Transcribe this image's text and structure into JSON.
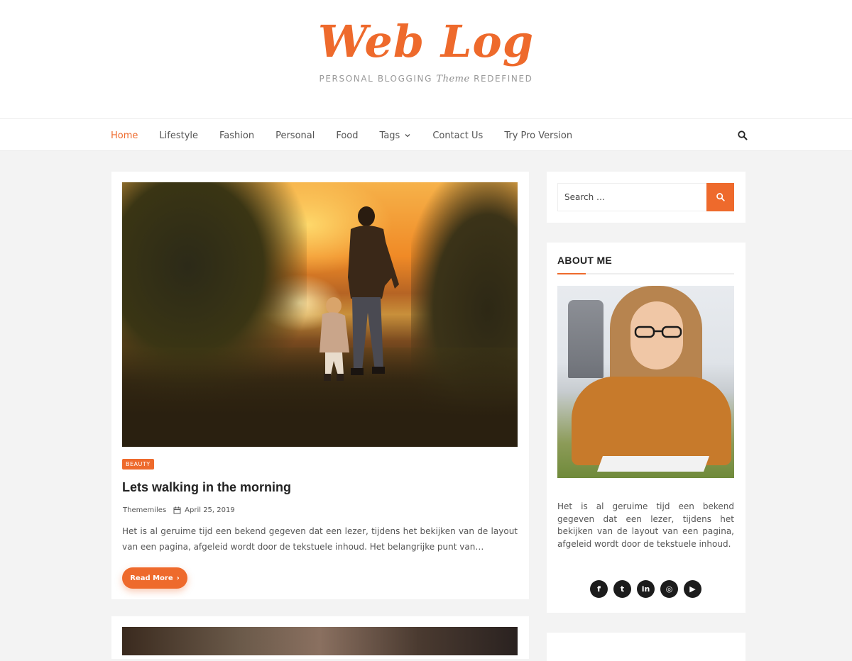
{
  "site": {
    "title": "Web Log",
    "tagline_before": "PERSONAL BLOGGING ",
    "tagline_script": "Theme",
    "tagline_after": " REDEFINED"
  },
  "nav": {
    "items": [
      {
        "label": "Home",
        "active": true
      },
      {
        "label": "Lifestyle"
      },
      {
        "label": "Fashion"
      },
      {
        "label": "Personal"
      },
      {
        "label": "Food"
      },
      {
        "label": "Tags",
        "has_dropdown": true
      },
      {
        "label": "Contact Us"
      },
      {
        "label": "Try Pro Version"
      }
    ],
    "search_icon": "search-icon"
  },
  "post": {
    "category": "BEAUTY",
    "title": "Lets walking in the morning",
    "author": "Thememiles",
    "date": "April 25, 2019",
    "excerpt": "Het is al geruime tijd een bekend gegeven dat een lezer, tijdens het bekijken van de layout van een pagina, afgeleid wordt door de tekstuele inhoud. Het belangrijke punt van…",
    "read_more": "Read More"
  },
  "sidebar": {
    "search": {
      "placeholder": "Search …"
    },
    "about": {
      "title": "ABOUT ME",
      "text": "Het is al geruime tijd een bekend gegeven dat een lezer, tijdens het bekijken van de layout van een pagina, afgeleid wordt door de tekstuele inhoud."
    },
    "social": [
      {
        "icon": "facebook-icon",
        "glyph": "f"
      },
      {
        "icon": "twitter-icon",
        "glyph": "t"
      },
      {
        "icon": "linkedin-icon",
        "glyph": "in"
      },
      {
        "icon": "instagram-icon",
        "glyph": "◎"
      },
      {
        "icon": "youtube-icon",
        "glyph": "▶"
      }
    ]
  },
  "colors": {
    "accent": "#ee6a2c",
    "background": "#f3f3f3",
    "text": "#555555"
  }
}
